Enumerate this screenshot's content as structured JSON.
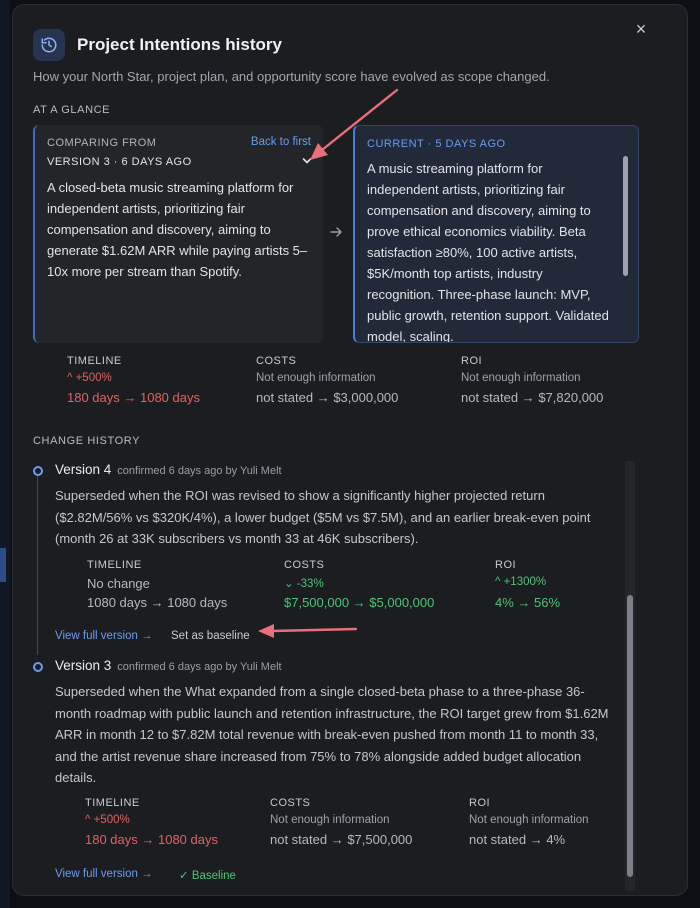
{
  "modal": {
    "title": "Project Intentions history",
    "subtitle": "How your North Star, project plan, and opportunity score have evolved as scope changed.",
    "close_icon": "×"
  },
  "glance": {
    "label": "AT A GLANCE",
    "from": {
      "label": "COMPARING FROM",
      "back_link": "Back to first",
      "version": "VERSION 3 · 6 DAYS AGO",
      "text": "A closed-beta music streaming platform for independent artists, prioritizing fair compensation and discovery, aiming to generate $1.62M ARR while paying artists 5–10x more per stream than Spotify."
    },
    "current": {
      "label": "CURRENT · 5 DAYS AGO",
      "text": "A music streaming platform for independent artists, prioritizing fair compensation and discovery, aiming to prove ethical economics viability. Beta satisfaction ≥80%, 100 active artists, $5K/month top artists, industry recognition. Three-phase launch: MVP, public growth, retention support. Validated model, scaling."
    },
    "metrics": {
      "timeline": {
        "header": "TIMELINE",
        "delta": "^ +500%",
        "value": "180 days → 1080 days"
      },
      "costs": {
        "header": "COSTS",
        "delta": "Not enough information",
        "value": "not stated → $3,000,000"
      },
      "roi": {
        "header": "ROI",
        "delta": "Not enough information",
        "value": "not stated → $7,820,000"
      }
    }
  },
  "history": {
    "label": "CHANGE HISTORY",
    "entries": [
      {
        "name": "Version 4",
        "meta": "confirmed 6 days ago by Yuli Melt",
        "description": "Superseded when the ROI was revised to show a significantly higher projected return ($2.82M/56% vs $320K/4%), a lower budget ($5M vs $7.5M), and an earlier break-even point (month 26 at 33K subscribers vs month 33 at 46K subscribers).",
        "metrics": {
          "timeline": {
            "header": "TIMELINE",
            "delta": "No change",
            "value": "1080 days → 1080 days"
          },
          "costs": {
            "header": "COSTS",
            "delta": "⌄ -33%",
            "value": "$7,500,000 → $5,000,000"
          },
          "roi": {
            "header": "ROI",
            "delta": "^ +1300%",
            "value": "4% → 56%"
          }
        },
        "view_link": "View full version →",
        "action": "Set as baseline"
      },
      {
        "name": "Version 3",
        "meta": "confirmed 6 days ago by Yuli Melt",
        "description": "Superseded when the What expanded from a single closed-beta phase to a three-phase 36-month roadmap with public launch and retention infrastructure, the ROI target grew from $1.62M ARR in month 12 to $7.82M total revenue with break-even pushed from month 11 to month 33, and the artist revenue share increased from 75% to 78% alongside added budget allocation details.",
        "metrics": {
          "timeline": {
            "header": "TIMELINE",
            "delta": "^ +500%",
            "value": "180 days → 1080 days"
          },
          "costs": {
            "header": "COSTS",
            "delta": "Not enough information",
            "value": "not stated → $7,500,000"
          },
          "roi": {
            "header": "ROI",
            "delta": "Not enough information",
            "value": "not stated → 4%"
          }
        },
        "view_link": "View full version →",
        "baseline_tag": "✓ Baseline"
      }
    ]
  },
  "colors": {
    "accent": "#6b9cf0",
    "increase_red": "#e26262",
    "decrease_green": "#4fc37a",
    "annotation_arrow": "#e8707a"
  },
  "icons": {
    "title": "history-clock-icon",
    "close": "close-icon",
    "dropdown": "chevron-down-icon",
    "compare_arrow": "arrow-right-icon",
    "timeline_dot": "timeline-dot-icon",
    "up": "chevron-up-icon",
    "down": "chevron-down-icon",
    "check": "check-icon"
  }
}
